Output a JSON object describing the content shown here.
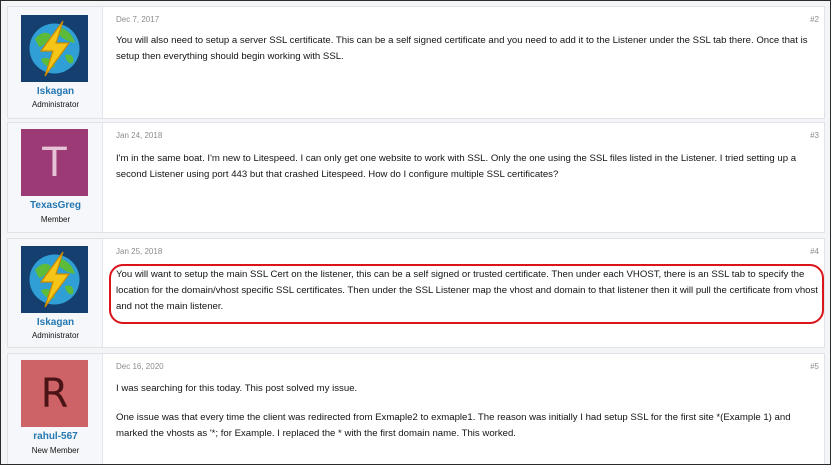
{
  "posts": [
    {
      "author": "Iskagan",
      "role": "Administrator",
      "date": "Dec 7, 2017",
      "number": "#2",
      "avatar_icon": "lightning-globe-icon",
      "paragraphs": [
        "You will also need to setup a server SSL certificate. This can be a self signed certificate and you need to add it to the Listener under the SSL tab there. Once that is setup then everything should begin working with SSL."
      ]
    },
    {
      "author": "TexasGreg",
      "role": "Member",
      "date": "Jan 24, 2018",
      "number": "#3",
      "avatar_letter": "T",
      "avatar_color": "#9b3a74",
      "paragraphs": [
        "I'm in the same boat. I'm new to Litespeed. I can only get one website to work with SSL. Only the one using the SSL files listed in the Listener. I tried setting up a second Listener using port 443 but that crashed Litespeed. How do I configure multiple SSL certificates?"
      ]
    },
    {
      "author": "Iskagan",
      "role": "Administrator",
      "date": "Jan 25, 2018",
      "number": "#4",
      "avatar_icon": "lightning-globe-icon",
      "highlight_color": "#d9141a",
      "paragraphs": [
        "You will want to setup the main SSL Cert on the listener, this can be a self signed or trusted certificate. Then under each VHOST, there is an SSL tab to specify the location for the domain/vhost specific SSL certificates. Then under the SSL Listener map the vhost and domain to that listener then it will pull the certificate from vhost and not the main listener."
      ]
    },
    {
      "author": "rahul-567",
      "role": "New Member",
      "date": "Dec 16, 2020",
      "number": "#5",
      "avatar_letter": "R",
      "avatar_color": "#cd6366",
      "paragraphs": [
        "I was searching for this today. This post solved my issue.",
        "One issue was that every time the client was redirected from Exmaple2 to exmaple1. The reason was initially I had setup SSL for the first site *(Example 1) and marked the vhosts as '*; for Example. I replaced the * with the first domain name. This worked."
      ]
    }
  ]
}
